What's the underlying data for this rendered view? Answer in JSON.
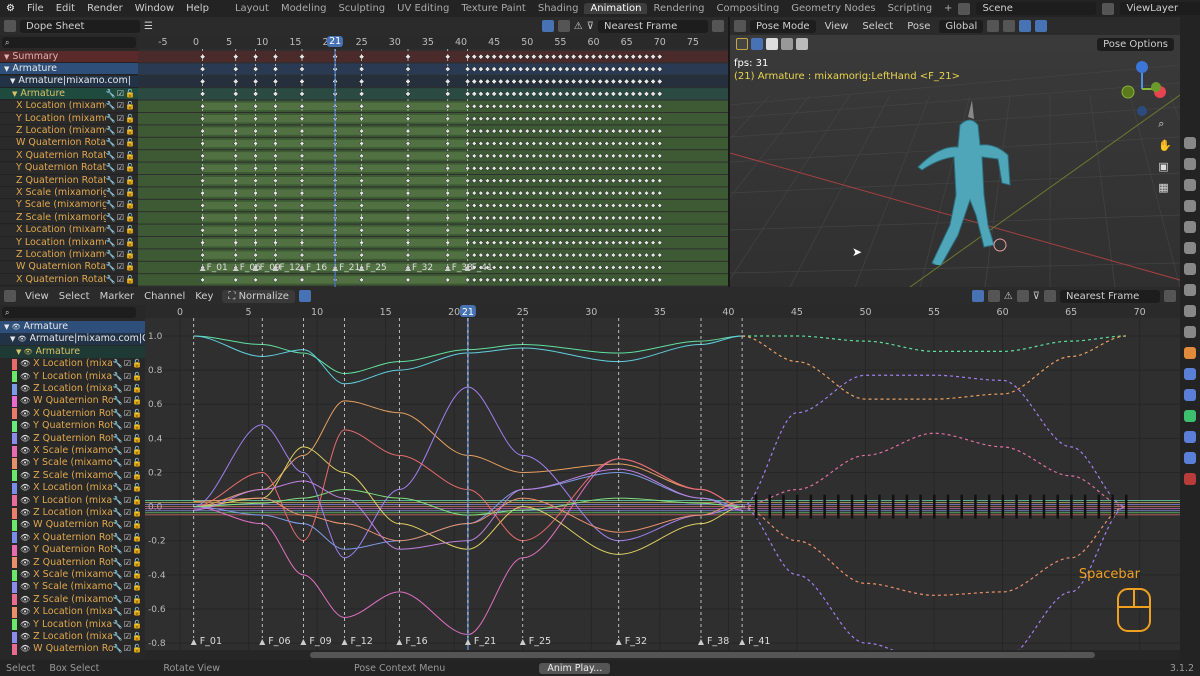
{
  "topbar": {
    "menus": [
      "File",
      "Edit",
      "Render",
      "Window",
      "Help"
    ],
    "workspaces": [
      "Layout",
      "Modeling",
      "Sculpting",
      "UV Editing",
      "Texture Paint",
      "Shading",
      "Animation",
      "Rendering",
      "Compositing",
      "Geometry Nodes",
      "Scripting",
      "+"
    ],
    "active_workspace": "Animation",
    "scene": "Scene",
    "view_layer": "ViewLayer"
  },
  "dopesheet": {
    "mode": "Dope Sheet",
    "snap": "Nearest Frame",
    "ruler": [
      -5,
      0,
      5,
      10,
      15,
      20,
      25,
      30,
      35,
      40,
      45,
      50,
      55,
      60,
      65,
      70,
      75
    ],
    "current_frame": "21",
    "channels": [
      {
        "label": "Summary",
        "kind": "summary"
      },
      {
        "label": "Armature",
        "kind": "object"
      },
      {
        "label": "Armature|mixamo.com|",
        "kind": "action"
      },
      {
        "label": "Armature",
        "kind": "group"
      },
      {
        "label": "X Location (mixamorig:Hips)",
        "kind": "fcurve"
      },
      {
        "label": "Y Location (mixamorig:Hips)",
        "kind": "fcurve"
      },
      {
        "label": "Z Location (mixamorig:Hips)",
        "kind": "fcurve"
      },
      {
        "label": "W Quaternion Rotation",
        "kind": "fcurve"
      },
      {
        "label": "X Quaternion Rotation",
        "kind": "fcurve"
      },
      {
        "label": "Y Quaternion Rotation",
        "kind": "fcurve"
      },
      {
        "label": "Z Quaternion Rotation",
        "kind": "fcurve"
      },
      {
        "label": "X Scale (mixamorig:Hips)",
        "kind": "fcurve"
      },
      {
        "label": "Y Scale (mixamorig:Hips)",
        "kind": "fcurve"
      },
      {
        "label": "Z Scale (mixamorig:Hips)",
        "kind": "fcurve"
      },
      {
        "label": "X Location (mixamorig)",
        "kind": "fcurve"
      },
      {
        "label": "Y Location (mixamorig)",
        "kind": "fcurve"
      },
      {
        "label": "Z Location (mixamorig)",
        "kind": "fcurve"
      },
      {
        "label": "W Quaternion Rotation",
        "kind": "fcurve"
      },
      {
        "label": "X Quaternion Rotation",
        "kind": "fcurve"
      }
    ],
    "keyframes": [
      1,
      6,
      9,
      12,
      16,
      21,
      25,
      32,
      38,
      41
    ]
  },
  "markers": [
    {
      "label": "F_01",
      "frame": 1
    },
    {
      "label": "F_06",
      "frame": 6
    },
    {
      "label": "F_09",
      "frame": 9
    },
    {
      "label": "F_12",
      "frame": 12
    },
    {
      "label": "F_16",
      "frame": 16
    },
    {
      "label": "F_21",
      "frame": 21
    },
    {
      "label": "F_25",
      "frame": 25
    },
    {
      "label": "F_32",
      "frame": 32
    },
    {
      "label": "F_38",
      "frame": 38
    },
    {
      "label": "F_41",
      "frame": 41
    }
  ],
  "viewport": {
    "mode": "Pose Mode",
    "menus": [
      "View",
      "Select",
      "Pose"
    ],
    "orientation": "Global",
    "pose_options": "Pose Options",
    "fps": "fps: 31",
    "info": "(21) Armature : mixamorig:LeftHand <F_21>"
  },
  "graph": {
    "menus": [
      "View",
      "Select",
      "Marker",
      "Channel",
      "Key"
    ],
    "normalize": "Normalize",
    "snap": "Nearest Frame",
    "ruler": [
      0,
      5,
      10,
      15,
      20,
      25,
      30,
      35,
      40,
      45,
      50,
      55,
      60,
      65,
      70
    ],
    "current_frame": "21",
    "yticks": [
      "1.0",
      "0.8",
      "0.6",
      "0.4",
      "0.2",
      "0.0",
      "-0.2",
      "-0.4",
      "-0.6",
      "-0.8"
    ],
    "channels_top": [
      "Armature",
      "Armature|mixamo.com|C",
      "Armature"
    ],
    "channels": [
      {
        "label": "X Location (mixamorig:Hips)",
        "color": "#e86b6b"
      },
      {
        "label": "Y Location (mixamorig:Hips)",
        "color": "#6be86b"
      },
      {
        "label": "Z Location (mixamorig:Hips)",
        "color": "#7b9ae8"
      },
      {
        "label": "W Quaternion Rotation",
        "color": "#e86bd0"
      },
      {
        "label": "X Quaternion Rotation",
        "color": "#e87b6b"
      },
      {
        "label": "Y Quaternion Rotation",
        "color": "#6be87b"
      },
      {
        "label": "Z Quaternion Rotation",
        "color": "#8b8be8"
      },
      {
        "label": "X Scale (mixamorig)",
        "color": "#e86bb0"
      },
      {
        "label": "Y Scale (mixamorig)",
        "color": "#e8906b"
      },
      {
        "label": "Z Scale (mixamorig)",
        "color": "#6be86b"
      },
      {
        "label": "X Location (mixamorig)",
        "color": "#7b8be8"
      },
      {
        "label": "Y Location (mixamorig)",
        "color": "#e86ba0"
      },
      {
        "label": "Z Location (mixamorig)",
        "color": "#e8806b"
      },
      {
        "label": "W Quaternion Rotation",
        "color": "#6be86b"
      },
      {
        "label": "X Quaternion Rotation",
        "color": "#7b8be8"
      },
      {
        "label": "Y Quaternion Rotation",
        "color": "#e86bb0"
      },
      {
        "label": "Z Quaternion Rotation",
        "color": "#e8906b"
      },
      {
        "label": "X Scale (mixamorig)",
        "color": "#6be86b"
      },
      {
        "label": "Y Scale (mixamorig)",
        "color": "#8b8be8"
      },
      {
        "label": "Z Scale (mixamorig)",
        "color": "#e86b90"
      },
      {
        "label": "X Location (mixamorig)",
        "color": "#e8906b"
      },
      {
        "label": "Y Location (mixamorig)",
        "color": "#6be86b"
      },
      {
        "label": "Z Location (mixamorig)",
        "color": "#8b8be8"
      },
      {
        "label": "W Quaternion Rotation",
        "color": "#e86b90"
      }
    ],
    "key_frames": [
      1,
      6,
      9,
      12,
      16,
      21,
      25,
      32,
      38,
      41
    ],
    "curves": [
      {
        "color": "#5fe0a0",
        "keys": [
          1,
          0.95,
          0.9,
          0.78,
          0.85,
          0.92,
          0.95,
          0.9,
          0.97,
          1
        ]
      },
      {
        "color": "#5fd0e0",
        "keys": [
          1,
          0.88,
          0.92,
          0.72,
          0.8,
          0.9,
          0.93,
          0.85,
          0.95,
          1
        ]
      },
      {
        "color": "#e8a060",
        "keys": [
          0,
          0.1,
          0.3,
          0.62,
          0.55,
          0.3,
          0.2,
          0.25,
          0.1,
          0
        ]
      },
      {
        "color": "#a080f0",
        "keys": [
          0,
          0.48,
          0.2,
          -0.3,
          0.1,
          0.7,
          0.3,
          -0.2,
          -0.05,
          0
        ]
      },
      {
        "color": "#e070c0",
        "keys": [
          0,
          -0.1,
          -0.4,
          -0.65,
          -0.5,
          -0.75,
          -0.3,
          0.28,
          0.1,
          0
        ]
      },
      {
        "color": "#e0d060",
        "keys": [
          0,
          0.05,
          0.35,
          0.2,
          -0.1,
          -0.25,
          0,
          -0.28,
          -0.1,
          0
        ]
      },
      {
        "color": "#e86b6b",
        "keys": [
          0,
          0.2,
          -0.2,
          0.45,
          0.3,
          0.1,
          -0.2,
          0.28,
          0.1,
          0
        ]
      },
      {
        "color": "#7b9ae8",
        "keys": [
          0,
          -0.05,
          -0.1,
          -0.25,
          -0.2,
          -0.1,
          0.1,
          0.2,
          0.05,
          0
        ]
      },
      {
        "color": "#80e080",
        "keys": [
          0,
          0.02,
          0.05,
          0.1,
          0.05,
          -0.05,
          -0.02,
          0.05,
          0.02,
          0
        ]
      },
      {
        "color": "#e8906b",
        "keys": [
          0.03,
          0.05,
          -0.05,
          -0.1,
          -0.2,
          -0.1,
          0.05,
          -0.15,
          -0.05,
          0.03
        ]
      },
      {
        "color": "#c080e0",
        "keys": [
          -0.02,
          0.1,
          0.15,
          0.05,
          -0.25,
          -0.2,
          0.1,
          0.22,
          0.05,
          -0.02
        ]
      }
    ],
    "extrap_frames": [
      41,
      45,
      50,
      55,
      60,
      65,
      69
    ],
    "extrap_curves": [
      {
        "color": "#5fe0a0",
        "keys": [
          1,
          1,
          0.97,
          0.91,
          0.91,
          0.97,
          1
        ]
      },
      {
        "color": "#e8a060",
        "keys": [
          1,
          0.85,
          0.63,
          0.63,
          0.66,
          0.88,
          1
        ]
      },
      {
        "color": "#a080f0",
        "keys": [
          0,
          0.55,
          0.77,
          0.77,
          0.74,
          0.35,
          0
        ]
      },
      {
        "color": "#e070a0",
        "keys": [
          0,
          0.1,
          0.3,
          0.43,
          0.35,
          0.18,
          0
        ]
      },
      {
        "color": "#a080f0",
        "keys": [
          0,
          -0.4,
          -0.8,
          -0.92,
          -0.9,
          -0.5,
          0
        ]
      },
      {
        "color": "#e8906b",
        "keys": [
          0,
          -0.2,
          -0.45,
          -0.52,
          -0.5,
          -0.3,
          0
        ]
      }
    ]
  },
  "overlay": {
    "key_hint": "Spacebar"
  },
  "statusbar": {
    "items": [
      "Select",
      "Box Select",
      "Rotate View",
      "Pose Context Menu"
    ],
    "playing": "Anim Play...",
    "version": "3.1.2"
  }
}
